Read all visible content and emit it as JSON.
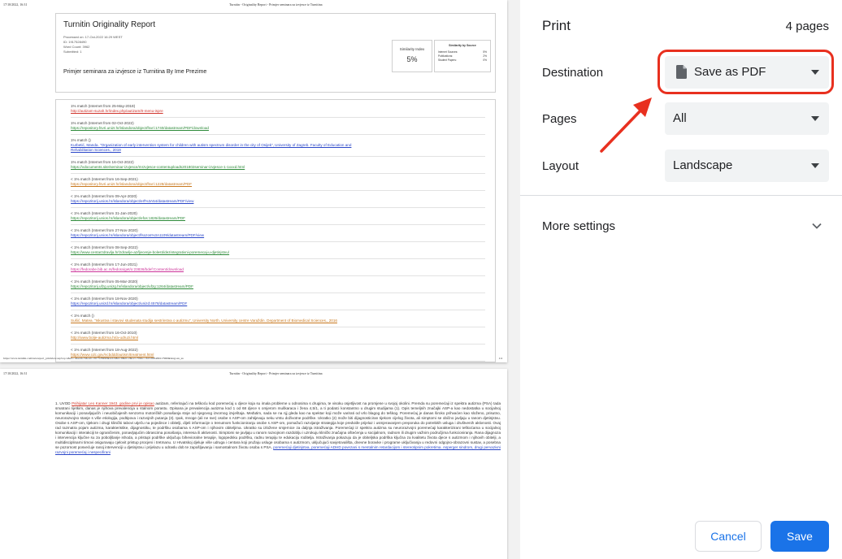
{
  "preview": {
    "page1": {
      "header_left": "17/10/2022, 16:31",
      "header_center": "Turnitin - Originality Report - Primjer seminara za izvjesce iz Turnitina",
      "footer_left": "https://www.turnitin.com/newreport_printview.asp?eq=1&eb=1&esm=5&oid=1917528490&sid=0&n=0&m=2&svr=55&r=16.61995489117960&lang=en_us",
      "footer_right": "1/4",
      "title": "Turnitin Originality Report",
      "meta": [
        "Processed on: 17-Oct-2022 16:29 WEST",
        "ID: 1917528490",
        "Word Count: 3962",
        "Submitted: 1"
      ],
      "subtitle": "Primjer seminara za izvjesce iz Turnitina By Ime Prezime",
      "similarity_label": "Similarity Index",
      "similarity_value": "5%",
      "sources_title": "Similarity by Source",
      "sources": [
        {
          "name": "Internet Sources:",
          "value": "5%"
        },
        {
          "name": "Publications:",
          "value": "2%"
        },
        {
          "name": "Student Papers:",
          "value": "0%"
        }
      ],
      "matches": [
        {
          "label": "1% match (Internet from 25-May-2019)",
          "links": [
            "http://autizam-suzah.hr/index.php/autizam/8-menu-ispre"
          ],
          "color": "#d0342c"
        },
        {
          "label": "1% match (Internet from 02-Oct-2022)",
          "links": [
            "https://repository.fsvri.unizr.hr/islandora/object/fsvri:1740/datastream/PDF/download"
          ],
          "color": "#2e8b3a"
        },
        {
          "label": "1% match ()",
          "links": [
            "Kurbetić, Manda. \"Organization of early intervention system for children with autism spectrum disorder in the city of Osijek\", University of Zagreb. Faculty of Education and",
            "Rehabilitation Sciences., 2019"
          ],
          "color": "#2a46c8"
        },
        {
          "label": "1% match (Internet from 16-Oct-2022)",
          "links": [
            "https://vdocuments.site/seminar-izvjesce/mrzvjesce-contentuploads201802seminar-izvjesce-1-1xxxd.html"
          ],
          "color": "#2e8b3a"
        },
        {
          "label": "< 1% match (Internet from 16-Sep-2021)",
          "links": [
            "https://repository.fsvri.unizr.hr/islandora/object/fsvri:1228/datastream/PDF"
          ],
          "color": "#c8781e"
        },
        {
          "label": "< 1% match (Internet from 09-Apr-2020)",
          "links": [
            "https://repozitorij.unios.hr/islandora/object/erf%3A54/datastream/PDF/view"
          ],
          "color": "#2a46c8"
        },
        {
          "label": "< 1% match (Internet from 31-Jan-2020)",
          "links": [
            "https://repozitorij.unios.hr/islandora/object/efos:1826/datastream/PDF"
          ],
          "color": "#2e8b3a"
        },
        {
          "label": "< 1% match (Internet from 27-Nov-2020)",
          "links": [
            "https://repozitorij.unios.hr/islandora/object/fsozos%3A1109/datastream/PDF/view"
          ],
          "color": "#2a46c8"
        },
        {
          "label": "< 1% match (Internet from 08-Sep-2022)",
          "links": [
            "https://www.centarzdravlja.hr/zdravlje-az/ljecenje-bolesti/dezintegrativni-poremecaj-u-djetinjstvu/"
          ],
          "color": "#2e8b3a"
        },
        {
          "label": "< 1% match (Internet from 17-Jun-2021)",
          "links": [
            "https://fedorabe.bib.ac.rs/fedora/get/o:23836/bdef:Content/download"
          ],
          "color": "#cc3399"
        },
        {
          "label": "< 1% match (Internet from 05-Mar-2020)",
          "links": [
            "https://repozitorij.ufzg.unizg.hr/islandora/object/ufzg:1264/datastream/PDF"
          ],
          "color": "#2e8b3a"
        },
        {
          "label": "< 1% match (Internet from 18-Nov-2020)",
          "links": [
            "https://repozitorij.unizd.hr/islandora/object/unizd:4578/datastream/PDF"
          ],
          "color": "#2a46c8"
        },
        {
          "label": "< 1% match ()",
          "links": [
            "Sušić, Matea. \"Iskustva i stavovi studenata studija sestrinstva o autizmu\", University North. University centre Varaždin. Department of Biomedical Sciences., 2016"
          ],
          "color": "#c8781e"
        },
        {
          "label": "< 1% match (Internet from 16-Oct-2010)",
          "links": [
            "http://www.bolje-autizma.hr/a-udruzi.html"
          ],
          "color": "#c8781e"
        },
        {
          "label": "< 1% match (Internet from 18-Aug-2022)",
          "links": [
            "https://www.cdc.gov/ncbddd/autism/treatment.html"
          ],
          "color": "#c8781e"
        }
      ]
    },
    "page2": {
      "header_left": "17/10/2022, 16:31",
      "header_center": "Turnitin - Originality Report - Primjer seminara za izvjesce iz Turnitina",
      "body_highlight_1": "Psihijatar Leo Kanner 1943. godine prvi je opisao",
      "body_text": "autizam, referirajući na teškoću kod poremećaj u djece koja su imala probleme u odnosima s drugima, te visoku osjetljivost na promjene u svojoj okolini. Premda su poremećaji iz spektra autizma (PSA) tada smatrani rijetkim, danas je njihova prevalencija u stalnom porastu. Opisana je prevalencija autizma kod 1 od 68 djece s omjerom muškaraca i žena 4,5/1, a ti podatci konstantno u drugim studijama (1). Opis temeljnih značajki ASP-a kao nedostatka u socijalnoj komunikaciji i ponavljajućih i neuobičajenih senzorno motoričkih ponašanja stoje od njegovog izvornog izvještaja. Međutim, sada se na njj gleda kao na spektar koji može varirati od vrlo blagog do teškog. Poremećaj je danas široko prihvaćen kao složeno, prisutno, neurorazvojno stanje s više etiologija, podtipova i razvojnih putanja (3). Ipak, mnoge (ali ne sve) osobe s ASP-om zahtijevaju neku vrstu doživotne podrške. Ukratko (2) može biti dijagnosticiran tijekom cijelog života, ali simptomi se obično javljaju u ranom djetinjstvu. Osobe s ASP-om, tijekom i drugi klinički tabovi utječu na pojedince i obitelji, dijeli informacije o trenutnom funkcioniranju osobe s ASP-om, pomažući razvijanje strategija koje predviđe prijelaz i usmjeravanjem preporuka do potrebitih usluga i društvenih aktivnosti. Ovaj rad razmatra pojam autizma, karakteristike, dijagnostiku, te podršku osobama s ASP-om i njihovim obiteljima. Ukratko su izložene smjernice za daljnja istraživanja. Poremećaji iz spektra autizma su neurorazvojni poremećaji karakterizirani teškoćama u socijalnoj komunikaciji i interakciji te ograničenim, ponavljajućim obrascima ponašanja, interesa ili aktivnosti. Simptomi se javljaju u ranom razvojnom razdoblju i uzrokuju klinički značajna oštećenja u socijalnom, radnom ili drugim važnim područjima funkcioniranja. Rana dijagnoza i intervencija ključne su za poboljšanje ishoda, a pristupi podrške uključuju bihevioralne terapije, logopedsku podršku, radnu terapiju te edukaciju roditelja. Istraživanja pokazuju da je obiteljska podrška ključna za kvalitetu života djece s autizmom i njihovih obitelji, a multidisciplinarni timovi osiguravaju cjelovit pristup procjeni i tretmanu. U Hrvatskoj djeluje više udruga i centara koji pružaju usluge osobama s autizmom, uključujući savjetovališta, dnevne boravke i programe uključivanja u redovni odgojno-obrazovni sustav, a posebna se pozornost posvećuje ranoj intervenciji u djetinjstvu i prijelazu u odraslu dob te zapošljavanju i samostalnom životu osoba s PSA.",
      "body_highlight_2": "poremećaji djetinjstva, poremećaji ADHD povezani s mentalnim retardacijom i stereotipnim pokretima. Asperger sindrom, drugi pervazivni razvojni poremećaj i nespecifirani"
    }
  },
  "settings": {
    "title": "Print",
    "page_count": "4 pages",
    "destination": {
      "label": "Destination",
      "value": "Save as PDF"
    },
    "pages": {
      "label": "Pages",
      "value": "All"
    },
    "layout": {
      "label": "Layout",
      "value": "Landscape"
    },
    "more_settings": "More settings",
    "cancel": "Cancel",
    "save": "Save"
  },
  "colors": {
    "accent": "#1a73e8",
    "annotation_red": "#e8301f",
    "select_bg": "#f1f3f4"
  },
  "icons": {
    "destination": "pdf-document-icon",
    "caret": "caret-down-icon",
    "more": "chevron-down-icon",
    "annotation": "red-arrow-annotation"
  }
}
